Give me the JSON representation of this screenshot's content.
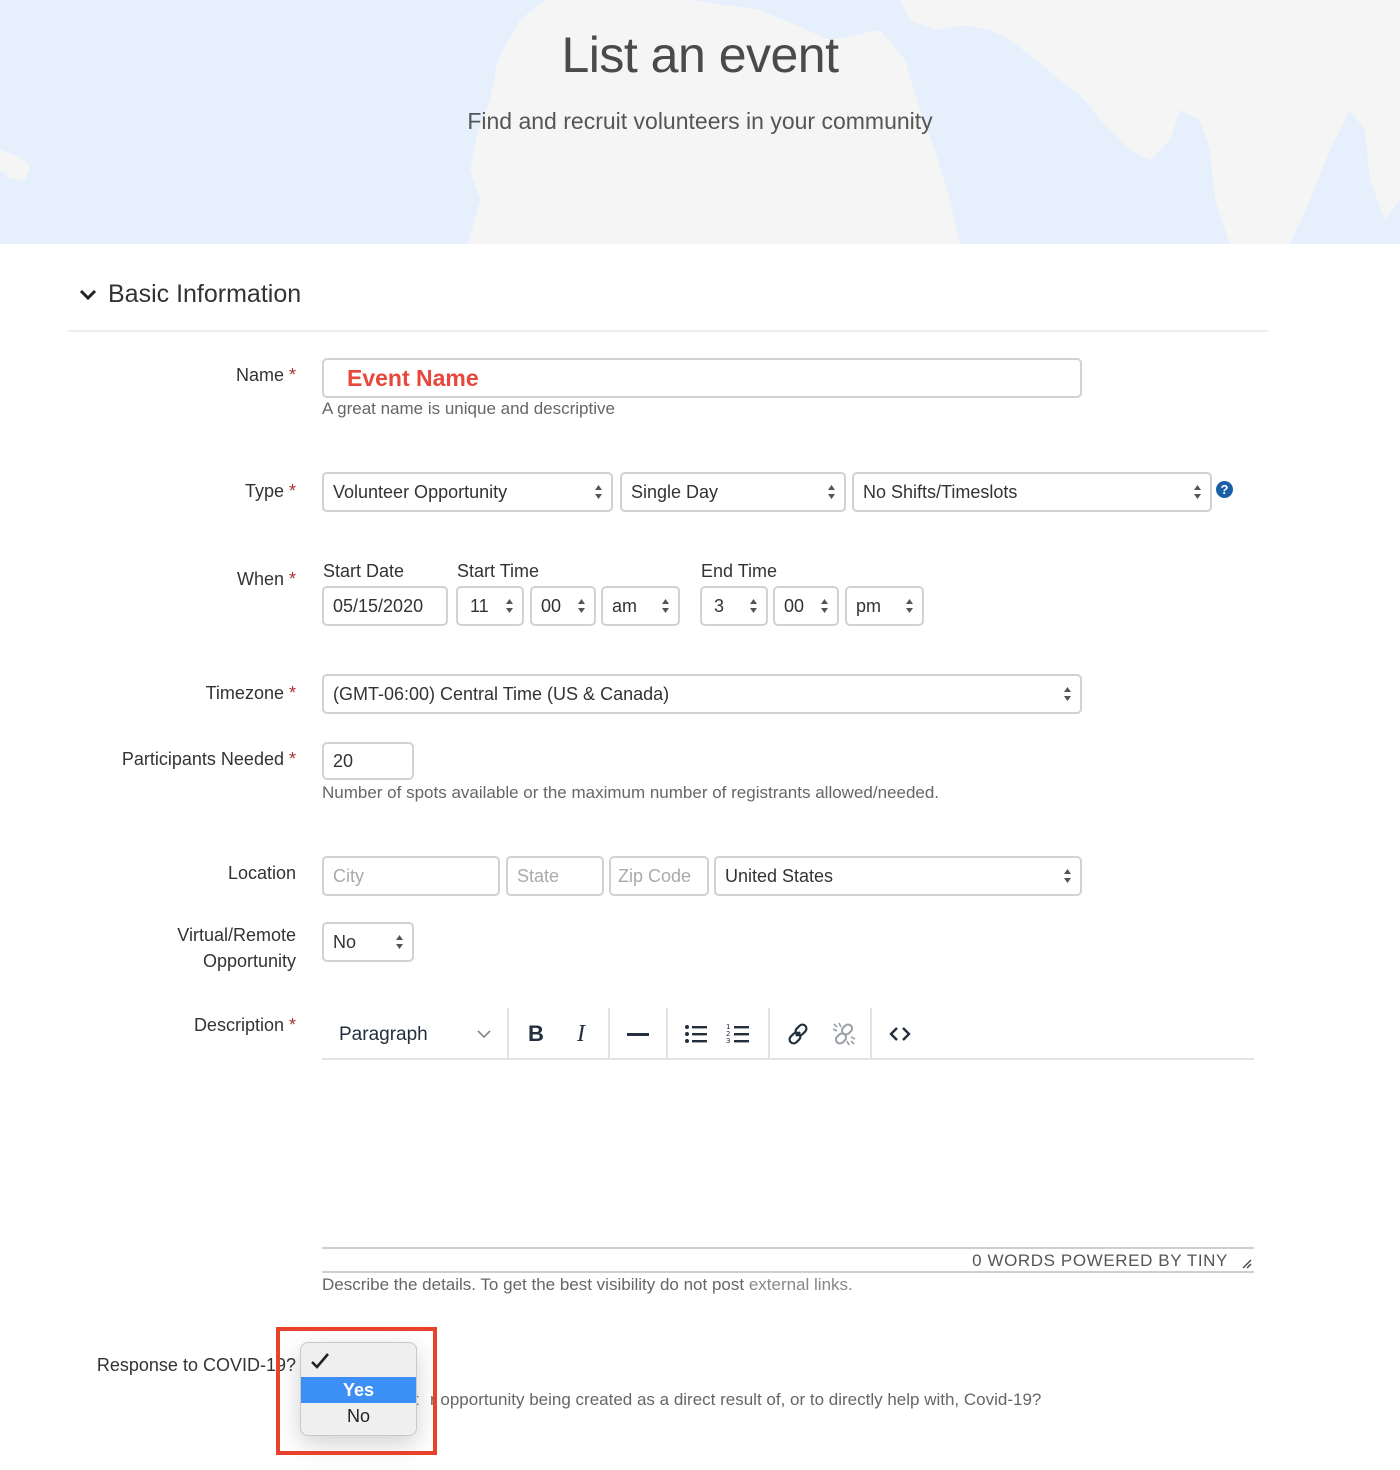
{
  "hero": {
    "title": "List an event",
    "subtitle": "Find and recruit volunteers in your community"
  },
  "section": {
    "title": "Basic Information",
    "icon": "chevron-down-icon"
  },
  "fields": {
    "name": {
      "label": "Name",
      "required": "*",
      "value": "Event Name",
      "help": "A great name is unique and descriptive"
    },
    "type": {
      "label": "Type",
      "required": "*",
      "category": "Volunteer Opportunity",
      "duration": "Single Day",
      "shifts": "No Shifts/Timeslots",
      "help_icon": "question-circle-icon"
    },
    "when": {
      "label": "When",
      "required": "*",
      "start_date_label": "Start Date",
      "start_date": "05/15/2020",
      "start_time_label": "Start Time",
      "start_hour": "11",
      "start_minute": "00",
      "start_ampm": "am",
      "end_time_label": "End Time",
      "end_hour": "3",
      "end_minute": "00",
      "end_ampm": "pm"
    },
    "timezone": {
      "label": "Timezone",
      "required": "*",
      "value": "(GMT-06:00) Central Time (US & Canada)"
    },
    "participants": {
      "label": "Participants Needed",
      "required": "*",
      "value": "20",
      "help": "Number of spots available or the maximum number of registrants allowed/needed."
    },
    "location": {
      "label": "Location",
      "city_placeholder": "City",
      "state_placeholder": "State",
      "zip_placeholder": "Zip Code",
      "country": "United States"
    },
    "virtual": {
      "label_line1": "Virtual/Remote",
      "label_line2": "Opportunity",
      "value": "No"
    },
    "description": {
      "label": "Description",
      "required": "*",
      "block_format": "Paragraph",
      "toolbar": {
        "bold": "B",
        "italic": "I"
      },
      "status": "0 WORDS  POWERED BY TINY",
      "help_prefix": "Describe the details. To get the best visibility do not post ",
      "help_link": "external links."
    },
    "covid": {
      "label": "Response to COVID-19?",
      "help_visible": "r opportunity being created as a direct result of, or to directly help with, Covid-19?",
      "help_partial_left": "t",
      "options": [
        "",
        "Yes",
        "No"
      ],
      "highlighted_option": "Yes",
      "checked_option": ""
    }
  },
  "colors": {
    "accent_red": "#e8483b",
    "required_star": "#a8322e",
    "dropdown_highlight": "#3c8ff5",
    "help_icon_blue": "#1a5ea8",
    "annotation_box": "#e8412c"
  }
}
